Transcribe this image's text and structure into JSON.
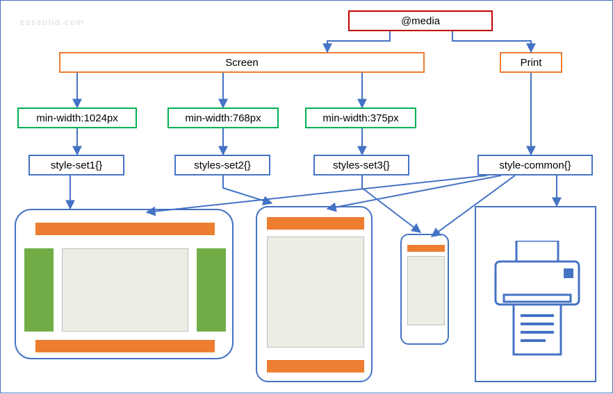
{
  "watermark": "csssolid.com",
  "nodes": {
    "media": "@media",
    "screen": "Screen",
    "print": "Print",
    "mq1": "min-width:1024px",
    "mq2": "min-width:768px",
    "mq3": "min-width:375px",
    "ss1": "style-set1{}",
    "ss2": "styles-set2{}",
    "ss3": "styles-set3{}",
    "ssCommon": "style-common{}"
  },
  "colors": {
    "arrow": "#4472C4",
    "red": "#C00000",
    "orange": "#ED7D31",
    "green": "#00B050",
    "blue": "#4472C4",
    "sidebar": "#70AD47",
    "body": "#EDEDE4"
  },
  "chart_data": {
    "type": "diagram",
    "title": "CSS @media query hierarchy",
    "root": "@media",
    "branches": [
      {
        "label": "Screen",
        "children": [
          {
            "condition": "min-width:1024px",
            "styles": "style-set1{}",
            "target": "desktop-layout"
          },
          {
            "condition": "min-width:768px",
            "styles": "styles-set2{}",
            "target": "tablet-layout"
          },
          {
            "condition": "min-width:375px",
            "styles": "styles-set3{}",
            "target": "phone-layout"
          }
        ]
      },
      {
        "label": "Print",
        "styles": "style-common{}",
        "target": "printer",
        "also_applies_to": [
          "desktop-layout",
          "tablet-layout",
          "phone-layout"
        ]
      }
    ]
  }
}
